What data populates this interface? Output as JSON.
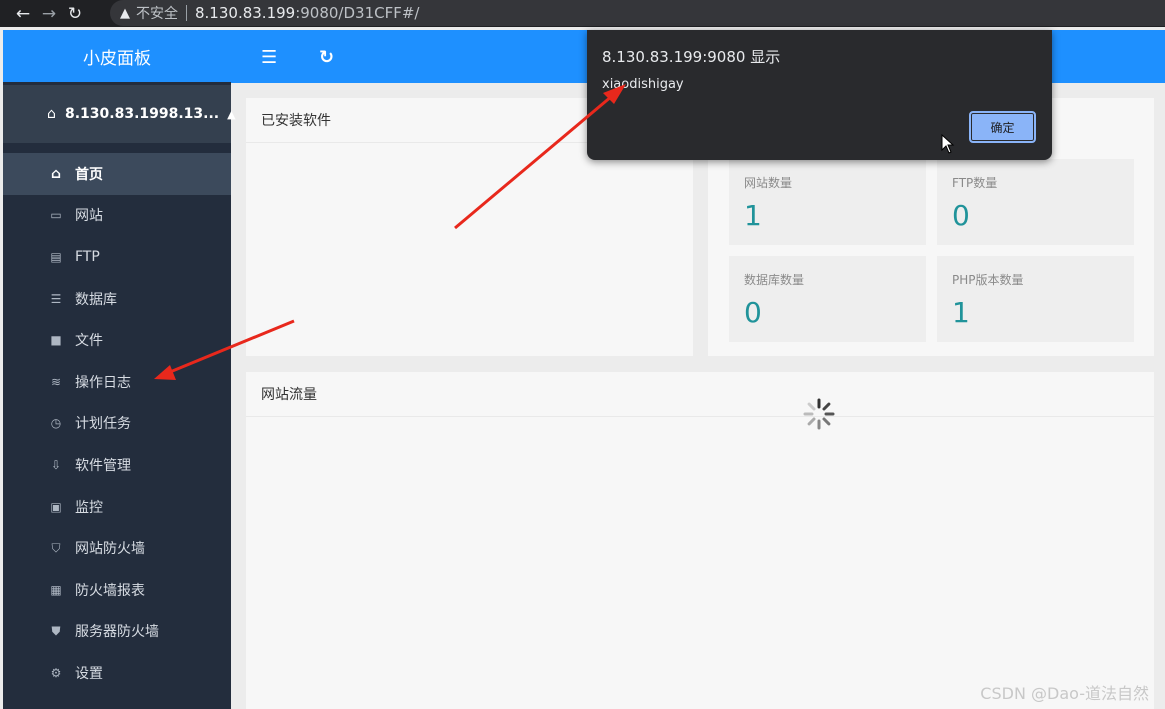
{
  "browser": {
    "back_icon": "arrow-left-icon",
    "insecure_label": "不安全",
    "url_host": "8.130.83.199",
    "url_rest": ":9080/D31CFF#/"
  },
  "sidebar": {
    "brand": "小皮面板",
    "server_name": "8.130.83.1998.13...",
    "items": [
      {
        "label": "首页",
        "icon": "home-icon"
      },
      {
        "label": "网站",
        "icon": "monitor-icon"
      },
      {
        "label": "FTP",
        "icon": "ftp-icon"
      },
      {
        "label": "数据库",
        "icon": "database-icon"
      },
      {
        "label": "文件",
        "icon": "folder-icon"
      },
      {
        "label": "操作日志",
        "icon": "layers-icon"
      },
      {
        "label": "计划任务",
        "icon": "clock-icon"
      },
      {
        "label": "软件管理",
        "icon": "download-icon"
      },
      {
        "label": "监控",
        "icon": "chart-monitor-icon"
      },
      {
        "label": "网站防火墙",
        "icon": "shield-icon"
      },
      {
        "label": "防火墙报表",
        "icon": "report-icon"
      },
      {
        "label": "服务器防火墙",
        "icon": "shield-check-icon"
      },
      {
        "label": "设置",
        "icon": "gear-icon"
      }
    ]
  },
  "content": {
    "installed_title": "已安装软件",
    "traffic_title": "网站流量",
    "stats": [
      {
        "label": "网站数量",
        "value": "1"
      },
      {
        "label": "FTP数量",
        "value": "0"
      },
      {
        "label": "数据库数量",
        "value": "0"
      },
      {
        "label": "PHP版本数量",
        "value": "1"
      }
    ]
  },
  "dialog": {
    "title": "8.130.83.199:9080 显示",
    "message": "xiaodishigay",
    "ok_label": "确定"
  },
  "colors": {
    "accent": "#1e90ff",
    "sidebar": "#232d3d",
    "stat_value": "#20939a",
    "annotation_arrow": "#e8281c"
  },
  "watermark": "CSDN @Dao-道法自然"
}
